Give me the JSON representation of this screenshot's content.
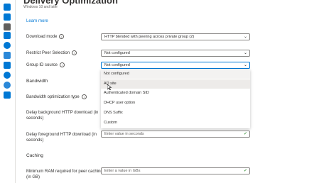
{
  "header": {
    "title": "Delivery Optimization",
    "subtitle": "Windows 10 and later"
  },
  "learn_more": "Learn more",
  "fields": {
    "download_mode": {
      "label": "Download mode",
      "value": "HTTP blended with peering across private group (2)"
    },
    "restrict_peer": {
      "label": "Restrict Peer Selection",
      "value": "Not configured"
    },
    "group_id_source": {
      "label": "Group ID source",
      "value": "Not configured"
    },
    "bandwidth_type": {
      "label": "Bandwidth optimization type"
    },
    "delay_bg": {
      "label_1": "Delay background HTTP download (in",
      "label_2": "seconds)"
    },
    "delay_fg": {
      "label_1": "Delay foreground HTTP download (in",
      "label_2": "seconds)",
      "placeholder": "Enter value in seconds"
    },
    "min_ram": {
      "label_1": "Minimum RAM required for peer caching",
      "label_2": "(in GB)",
      "placeholder": "Enter a value in GBs"
    }
  },
  "sections": {
    "bandwidth": "Bandwidth",
    "caching": "Caching"
  },
  "dropdown_options": [
    "Not configured",
    "AD site",
    "Authenticated domain SID",
    "DHCP user option",
    "DNS Suffix",
    "Custom"
  ],
  "icons": {
    "info": "i",
    "chevron": "⌄",
    "check": "✓"
  },
  "colors": {
    "accent": "#0078d4",
    "valid": "#107c10"
  }
}
